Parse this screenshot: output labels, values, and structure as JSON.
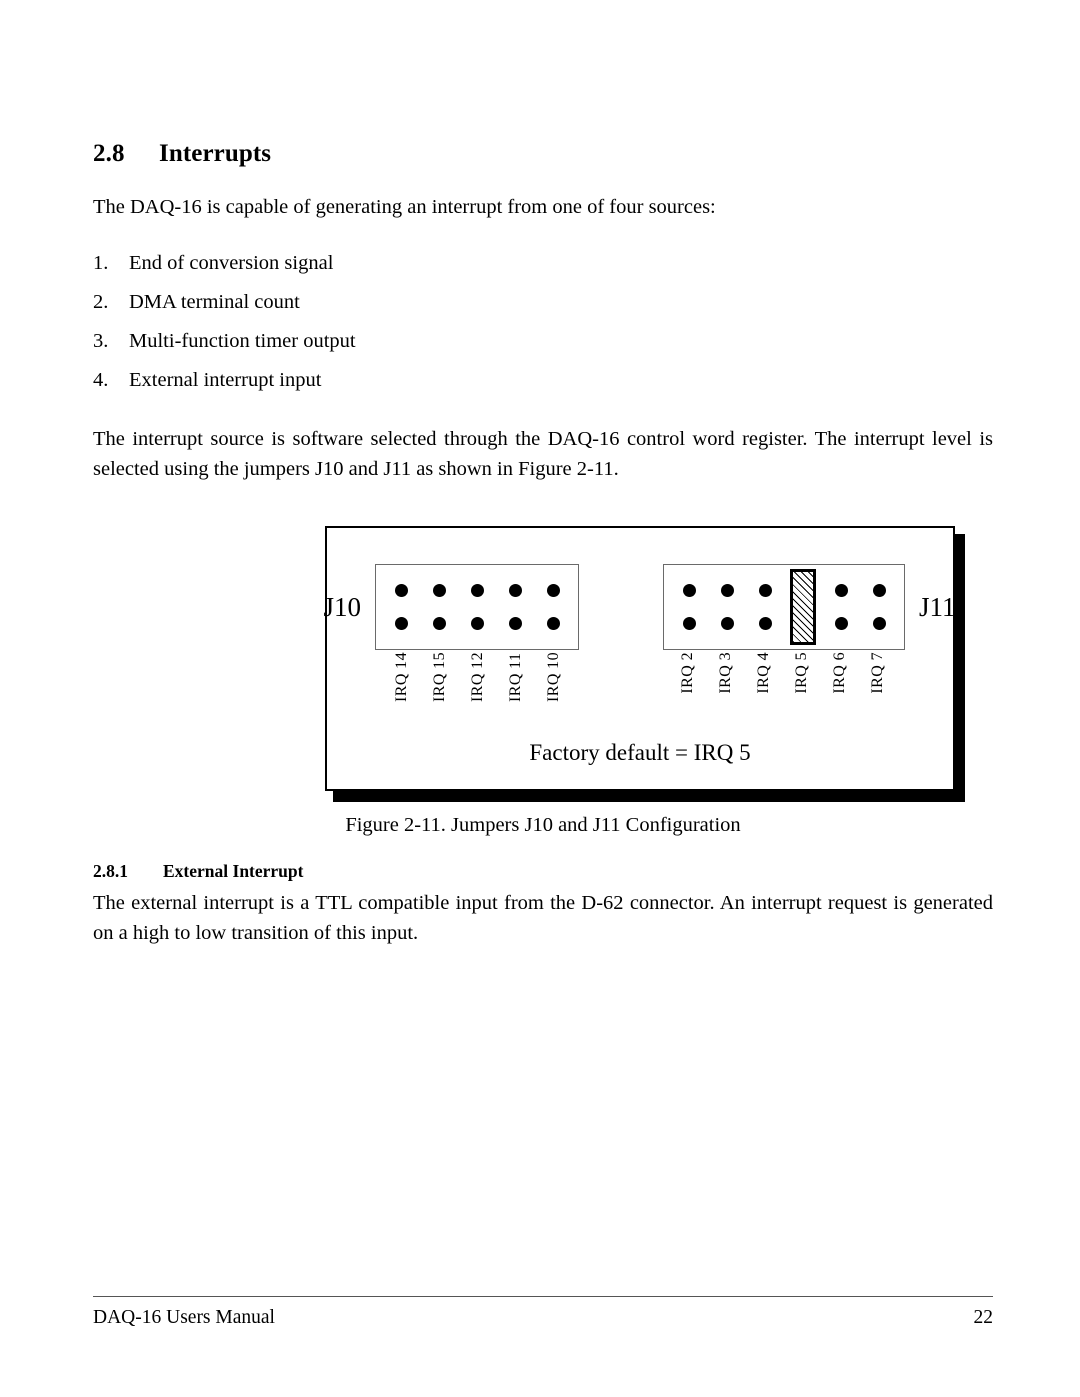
{
  "document": {
    "section": {
      "number": "2.8",
      "title": "Interrupts"
    },
    "intro_paragraph": "The DAQ-16 is capable of generating an interrupt from one of four sources:",
    "sources": [
      {
        "marker": "1.",
        "text": "End of conversion signal"
      },
      {
        "marker": "2.",
        "text": "DMA terminal count"
      },
      {
        "marker": "3.",
        "text": "Multi-function timer output"
      },
      {
        "marker": "4.",
        "text": "External interrupt input"
      }
    ],
    "body_paragraph": "The interrupt source is software selected through the DAQ-16 control word register. The interrupt level is selected using the jumpers J10 and J11 as shown in Figure 2-11.",
    "figure": {
      "caption": "Figure 2-11. Jumpers J10 and J11 Configuration",
      "default_note": "Factory default = IRQ 5",
      "jumper_left": {
        "label": "J10",
        "pins": [
          "IRQ 14",
          "IRQ 15",
          "IRQ 12",
          "IRQ 11",
          "IRQ 10"
        ],
        "shunt_position": null
      },
      "jumper_right": {
        "label": "J11",
        "pins": [
          "IRQ 2",
          "IRQ 3",
          "IRQ 4",
          "IRQ 5",
          "IRQ 6",
          "IRQ 7"
        ],
        "shunt_position": "IRQ 5"
      }
    },
    "subsection": {
      "number": "2.8.1",
      "title": "External Interrupt",
      "paragraph": "The external interrupt is a TTL compatible input from the D-62 connector. An interrupt request is generated on a high to low transition of this input."
    }
  },
  "footer": {
    "manual_title": "DAQ-16 Users Manual",
    "page_number": "22"
  }
}
